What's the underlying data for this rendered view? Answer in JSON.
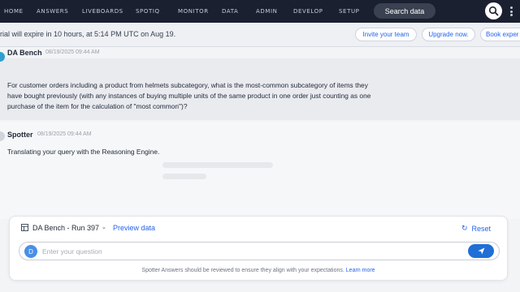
{
  "topnav": {
    "items": [
      "HOME",
      "ANSWERS",
      "LIVEBOARDS",
      "SPOTIQ",
      "MONITOR",
      "DATA",
      "ADMIN",
      "DEVELOP",
      "SETUP"
    ],
    "search_label": "Search data"
  },
  "banner": {
    "text": "rial will expire in 10 hours, at 5:14 PM UTC on Aug 19.",
    "invite_label": "Invite your team",
    "upgrade_label": "Upgrade now.",
    "book_label": "Book exper"
  },
  "user_message": {
    "sender": "DA Bench",
    "timestamp": "08/19/2025 09:44 AM",
    "lines": [
      "For customer orders including a product from helmets subcategory, what is the most-common subcategory of items they",
      "have bought previously (with any instances of buying multiple units of the same product in one order just counting as one",
      "purchase of the item for the calculation of \"most common\")?"
    ]
  },
  "bot_message": {
    "sender": "Spotter",
    "timestamp": "08/19/2025 09:44 AM",
    "text": "Translating your query with the Reasoning Engine."
  },
  "composer": {
    "datasource": "DA Bench - Run 397",
    "preview_label": "Preview data",
    "reset_label": "Reset",
    "avatar_initial": "D",
    "placeholder": "Enter your question",
    "disclaimer": "Spotter Answers should be reviewed to ensure they align with your expectations.",
    "learn_more": "Learn more"
  },
  "colors": {
    "nav_bg": "#1b2030",
    "accent": "#2563eb",
    "send_bg": "#1f6fd6",
    "avatar_bg": "#4a8fe7"
  },
  "icons": {
    "search": "search-icon",
    "menu": "more-vertical-icon",
    "table": "table-icon",
    "chevron": "chevron-down-icon",
    "reset": "refresh-icon",
    "send": "send-icon"
  }
}
